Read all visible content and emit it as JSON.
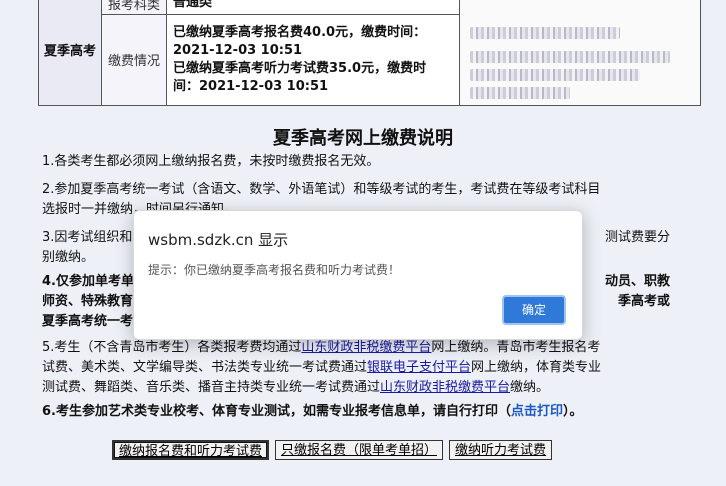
{
  "info_table": {
    "top_label": "报考科类",
    "top_value": "普通类",
    "row_header": "夏季高考",
    "fee_label": "缴费情况",
    "fee_lines": [
      "已缴纳夏季高考报名费40.0元，缴费时间：",
      "2021-12-03 10:51",
      "已缴纳夏季高考听力考试费35.0元，缴费时",
      "间：2021-12-03 10:51"
    ]
  },
  "title": "夏季高考网上缴费说明",
  "paragraphs": {
    "p1": "1.各类考生都必须网上缴纳报名费，未按时缴费报名无效。",
    "p2a": "2.参加夏季高考统一考试（含语文、数学、外语笔试）和等级考试的考生，考试费在等级考试科目",
    "p2b": "选报时一并缴纳，时间另行通知。",
    "p3a": "3.因考试组织和",
    "p3a_end": "测试费要分",
    "p3b": "别缴纳。",
    "p4a": "4.仅参加单考单",
    "p4a_end": "动员、职教",
    "p4b": "师资、特殊教育",
    "p4b_end": "季高考或",
    "p4c": "夏季高考统一考",
    "p5a_1": "5.考生（不含青岛市考生）各类报考费均通过",
    "p5a_link": "山东财政非税缴费平台",
    "p5a_2": "网上缴纳。青岛市考生报名考",
    "p5b_1": "试费、美术类、文学编导类、书法类专业统一考试费通过",
    "p5b_link": "银联电子支付平台",
    "p5b_2": "网上缴纳，体育类专业",
    "p5c": "测试费、舞蹈类、音乐类、播音主持类专业统一考试费通过",
    "p5c_link": "山东财政非税缴费平台",
    "p5c_2": "缴纳。",
    "p6": "6.考生参加艺术类专业校考、体育专业测试，如需专业报考信息单，请自行打印（",
    "p6_link": "点击打印",
    "p6_end": "）。"
  },
  "buttons": {
    "pay_both": "缴纳报名费和听力考试费",
    "pay_registration": "只缴报名费（限单考单招）",
    "pay_listening": "缴纳听力考试费"
  },
  "dialog": {
    "title": "wsbm.sdzk.cn 显示",
    "message": "提示：你已缴纳夏季高考报名费和听力考试费！",
    "ok": "确定"
  }
}
